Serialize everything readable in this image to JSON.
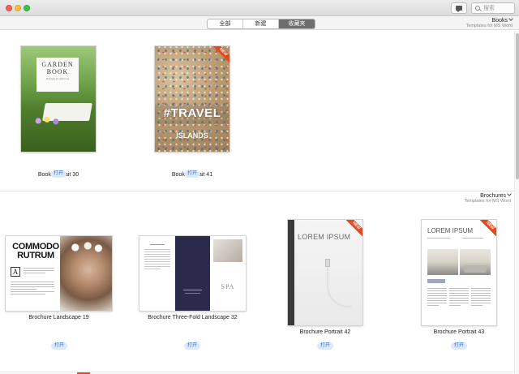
{
  "titlebar": {
    "search_placeholder": "搜索",
    "icons": {
      "message": "message-bubble-icon",
      "search": "magnifier-icon"
    }
  },
  "toolbar": {
    "tabs": [
      {
        "label": "全部",
        "active": false
      },
      {
        "label": "新建",
        "active": false
      },
      {
        "label": "收藏夹",
        "active": true
      }
    ],
    "category": {
      "name": "Books",
      "subtitle": "Templates for MS Word"
    }
  },
  "sections": [
    {
      "name": "Books",
      "subtitle": "Templates for MS Word",
      "items": [
        {
          "title": "Book Portrait 30",
          "open_label": "打开",
          "new_badge": false,
          "cover": {
            "heading": "GARDEN BOOK",
            "subheading": "Principes for Adfoccing"
          }
        },
        {
          "title": "Book Portrait 41",
          "open_label": "打开",
          "new_badge": true,
          "badge_label": "NEW",
          "cover": {
            "heading": "#TRAVEL",
            "subheading": "ISLANDS"
          }
        }
      ]
    },
    {
      "name": "Brochures",
      "subtitle": "Templates for MS Word",
      "items": [
        {
          "title": "Brochure Landscape 19",
          "open_label": "打开",
          "new_badge": false,
          "cover": {
            "heading_line1": "COMMODO",
            "heading_line2": "RUTRUM",
            "initial": "A"
          }
        },
        {
          "title": "Brochure Three-Fold Landscape 32",
          "open_label": "打开",
          "new_badge": false,
          "cover": {
            "logo": "SPA"
          }
        },
        {
          "title": "Brochure Portrait 42",
          "open_label": "打开",
          "new_badge": true,
          "badge_label": "NEW",
          "cover": {
            "heading": "LOREM IPSUM"
          }
        },
        {
          "title": "Brochure Portrait 43",
          "open_label": "打开",
          "new_badge": true,
          "badge_label": "NEW",
          "cover": {
            "heading": "LOREM IPSUM"
          }
        }
      ]
    }
  ],
  "colors": {
    "open_button_bg": "#dce9fb",
    "open_button_text": "#2f6fd6",
    "new_ribbon": "#e24b1f",
    "active_tab": "#6e6e6e"
  }
}
